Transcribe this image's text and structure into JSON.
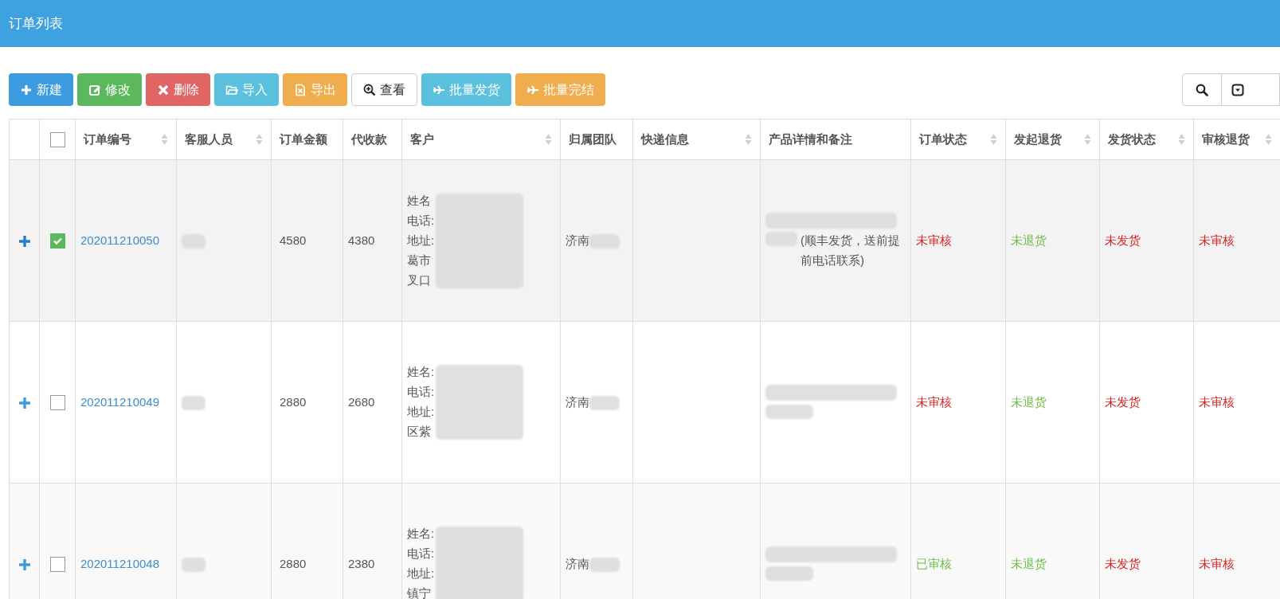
{
  "header": {
    "title": "订单列表"
  },
  "toolbar": [
    {
      "kind": "new",
      "label": "新建"
    },
    {
      "kind": "edit",
      "label": "修改"
    },
    {
      "kind": "delete",
      "label": "删除"
    },
    {
      "kind": "import",
      "label": "导入"
    },
    {
      "kind": "export",
      "label": "导出"
    },
    {
      "kind": "view",
      "label": "查看"
    },
    {
      "kind": "ship",
      "label": "批量发货"
    },
    {
      "kind": "finish",
      "label": "批量完结"
    }
  ],
  "table": {
    "select_all": {
      "checked": false
    },
    "columns": [
      {
        "label": "订单编号",
        "sortable": true
      },
      {
        "label": "客服人员",
        "sortable": true
      },
      {
        "label": "订单金额",
        "sortable": false
      },
      {
        "label": "代收款",
        "sortable": false
      },
      {
        "label": "客户",
        "sortable": true
      },
      {
        "label": "归属团队",
        "sortable": false
      },
      {
        "label": "快递信息",
        "sortable": true
      },
      {
        "label": "产品详情和备注",
        "sortable": false
      },
      {
        "label": "订单状态",
        "sortable": true
      },
      {
        "label": "发起退货",
        "sortable": true
      },
      {
        "label": "发货状态",
        "sortable": true
      },
      {
        "label": "审核退货",
        "sortable": true
      }
    ],
    "rows": [
      {
        "selected": true,
        "order_no": "202011210050",
        "amount": "4580",
        "cod": "4380",
        "customer": [
          "姓名",
          "电话:",
          "地址:",
          "葛市",
          "叉口"
        ],
        "team": "济南",
        "note": "(顺丰发货，送前提前电话联系)",
        "statuses": [
          {
            "text": "未审核",
            "color": "#e02020"
          },
          {
            "text": "未退货",
            "color": "#6cbe45"
          },
          {
            "text": "未发货",
            "color": "#e02020"
          },
          {
            "text": "未审核",
            "color": "#e02020"
          }
        ]
      },
      {
        "selected": false,
        "order_no": "202011210049",
        "amount": "2880",
        "cod": "2680",
        "customer": [
          "姓名:",
          "电话:",
          "地址:",
          "区紫"
        ],
        "team": "济南",
        "note": "",
        "statuses": [
          {
            "text": "未审核",
            "color": "#e02020"
          },
          {
            "text": "未退货",
            "color": "#6cbe45"
          },
          {
            "text": "未发货",
            "color": "#e02020"
          },
          {
            "text": "未审核",
            "color": "#e02020"
          }
        ]
      },
      {
        "selected": false,
        "order_no": "202011210048",
        "amount": "2880",
        "cod": "2380",
        "customer": [
          "姓名:",
          "电话:",
          "地址:",
          "镇宁"
        ],
        "team": "济南",
        "note": "",
        "statuses": [
          {
            "text": "已审核",
            "color": "#6cbe45"
          },
          {
            "text": "未退货",
            "color": "#6cbe45"
          },
          {
            "text": "未发货",
            "color": "#e02020"
          },
          {
            "text": "未审核",
            "color": "#e02020"
          }
        ]
      }
    ]
  }
}
